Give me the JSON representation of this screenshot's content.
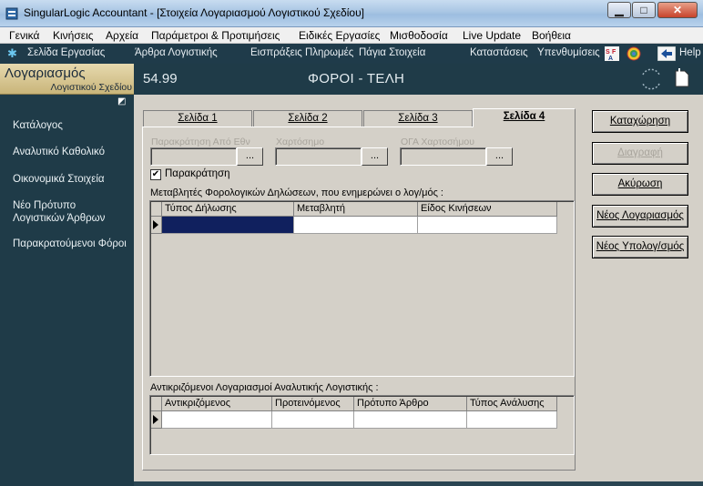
{
  "window": {
    "title": "SingularLogic Accountant - [Στοιχεία Λογαριασμού Λογιστικού Σχεδίου]"
  },
  "menu": {
    "items": [
      "Γενικά",
      "Κινήσεις",
      "Αρχεία",
      "Παράμετροι & Προτιμήσεις",
      "Ειδικές Εργασίες",
      "Μισθοδοσία",
      "Live Update",
      "Βοήθεια"
    ]
  },
  "toolbar": {
    "items": [
      "Σελίδα Εργασίας",
      "Άρθρα Λογιστικής",
      "Εισπράξεις",
      "Πληρωμές",
      "Πάγια Στοιχεία",
      "Καταστάσεις",
      "Υπενθυμίσεις",
      "Help"
    ]
  },
  "sidebar": {
    "title": "Λογαριασμός",
    "subtitle": "Λογιστικού Σχεδίου",
    "items": [
      "Κατάλογος",
      "Αναλυτικό Καθολικό",
      "Οικονομικά Στοιχεία",
      "Νέο Πρότυπο Λογιστικών Άρθρων",
      "Παρακρατούμενοι Φόροι"
    ]
  },
  "header": {
    "account_code": "54.99",
    "account_name": "ΦΟΡΟΙ - ΤΕΛΗ"
  },
  "tabs": [
    "Σελίδα 1",
    "Σελίδα 2",
    "Σελίδα 3",
    "Σελίδα 4"
  ],
  "active_tab": "Σελίδα 4",
  "form": {
    "field1_label": "Παρακράτηση Από Εθν",
    "field2_label": "Χαρτόσημο",
    "field3_label": "ΟΓΑ Χαρτοσήμου",
    "lookup_button": "...",
    "checkbox_label": "Παρακράτηση",
    "checkbox_checked": true,
    "grid1_label": "Μεταβλητές Φορολογικών Δηλώσεων, που ενημερώνει ο λογ/μός :",
    "grid1_columns": [
      "Τύπος Δήλωσης",
      "Μεταβλητή",
      "Είδος Κινήσεων"
    ],
    "grid2_label": "Αντικριζόμενοι Λογαριασμοί Αναλυτικής Λογιστικής :",
    "grid2_columns": [
      "Αντικριζόμενος",
      "Προτεινόμενος",
      "Πρότυπο Άρθρο",
      "Τύπος Ανάλυσης"
    ]
  },
  "actions": {
    "save": "Καταχώρηση",
    "delete": "Διαγραφή",
    "cancel": "Ακύρωση",
    "new_account": "Νέος Λογαριασμός",
    "new_sub": "Νέος Υπολογ/σμός"
  }
}
